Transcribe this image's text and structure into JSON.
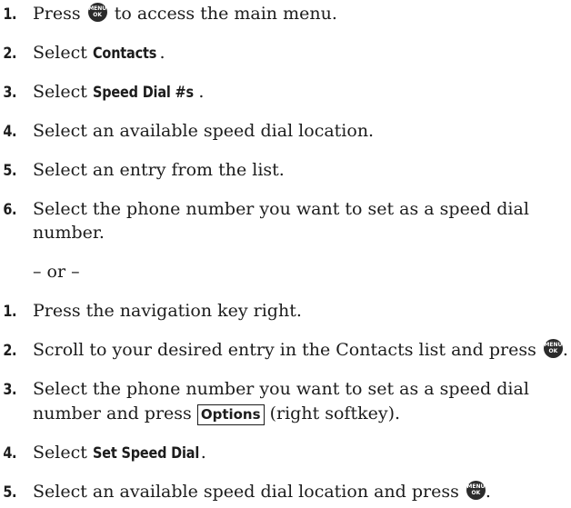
{
  "icons": {
    "menu_key": "menu-ok-key-icon",
    "menu_key_top": "MENU",
    "menu_key_bottom": "OK"
  },
  "group1": [
    {
      "num": "1.",
      "before": "Press",
      "after": "to access the main menu."
    },
    {
      "num": "2.",
      "before": "Select",
      "bold": "Contacts",
      "after": "."
    },
    {
      "num": "3.",
      "before": "Select",
      "bold": "Speed Dial #s",
      "after": "."
    },
    {
      "num": "4.",
      "text": "Select an available speed dial location."
    },
    {
      "num": "5.",
      "text": "Select an entry from the list."
    },
    {
      "num": "6.",
      "line1": "Select the phone number you want to set as a speed dial",
      "line2": "number."
    }
  ],
  "separator": "– or –",
  "group2": [
    {
      "num": "1.",
      "text": "Press the navigation key right."
    },
    {
      "num": "2.",
      "before": "Scroll to your desired entry in the Contacts list and press",
      "after": "."
    },
    {
      "num": "3.",
      "line1": "Select the phone number you want to set as a speed dial",
      "line2_before": "number and press",
      "softkey": "Options",
      "line2_after": "(right softkey)."
    },
    {
      "num": "4.",
      "before": "Select",
      "bold": "Set Speed Dial",
      "after": "."
    },
    {
      "num": "5.",
      "before": "Select an available speed dial location and press",
      "after": "."
    }
  ]
}
